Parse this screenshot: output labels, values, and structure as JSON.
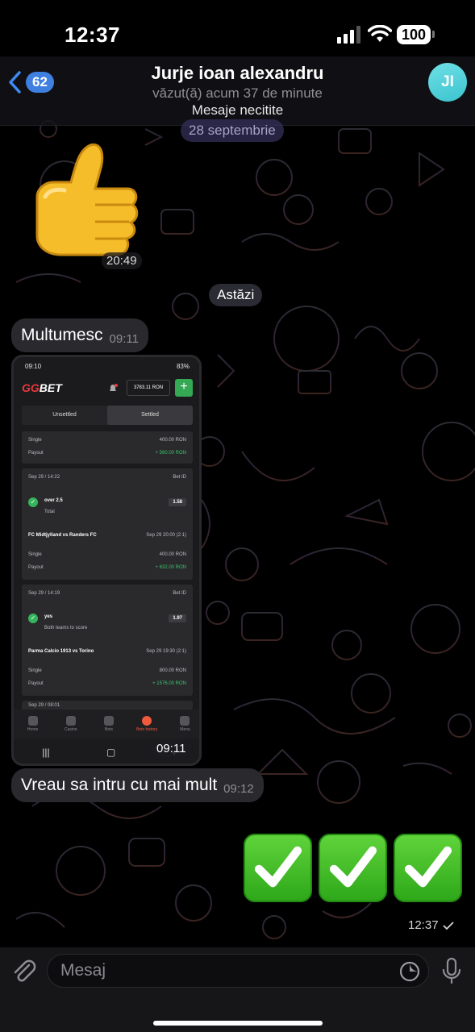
{
  "status_bar": {
    "time": "12:37",
    "battery": "100"
  },
  "header": {
    "back_count": "62",
    "title": "Jurje ioan alexandru",
    "subtitle": "văzut(ă) acum 37 de minute",
    "avatar_initials": "JI",
    "unread_label": "Mesaje necitite"
  },
  "dates": {
    "first": "28 septembrie",
    "today": "Astăzi"
  },
  "messages": {
    "sticker_time": "20:49",
    "m1_text": "Multumesc",
    "m1_time": "09:11",
    "image_time": "09:11",
    "m2_text": "Vreau sa intru cu mai mult",
    "m2_time": "09:12",
    "out_time": "12:37"
  },
  "screenshot": {
    "status_time": "09:10",
    "status_battery": "83%",
    "brand_gg": "GG",
    "brand_bet": "BET",
    "balance": "3783.11 RON",
    "plus": "+",
    "tab_unsettled": "Unsettled",
    "tab_settled": "Settled",
    "card0": {
      "type": "Single",
      "stake": "400.00 RON",
      "payout_label": "Payout",
      "payout": "+ 560.00 RON"
    },
    "card1": {
      "date": "Sep 29 / 14:22",
      "bet_id": "Bet ID",
      "pick": "over 2.5",
      "market": "Total",
      "odds": "1.58",
      "match": "FC Midtjylland vs Randers FC",
      "match_time": "Sep 29 20:00 (2:1)",
      "type": "Single",
      "stake": "400.00 RON",
      "payout_label": "Payout",
      "payout": "+ 632.00 RON"
    },
    "card2": {
      "date": "Sep 29 / 14:19",
      "bet_id": "Bet ID",
      "pick": "yes",
      "market": "Both teams to score",
      "odds": "1.97",
      "match": "Parma Calcio 1913 vs Torino",
      "match_time": "Sep 29 19:30 (2:1)",
      "type": "Single",
      "stake": "800.00 RON",
      "payout_label": "Payout",
      "payout": "+ 1576.00 RON"
    },
    "card3": {
      "date": "Sep 29 / 08:01"
    },
    "nav": [
      "Home",
      "Casino",
      "Bets",
      "Bets history",
      "Menu"
    ]
  },
  "input": {
    "placeholder": "Mesaj"
  }
}
